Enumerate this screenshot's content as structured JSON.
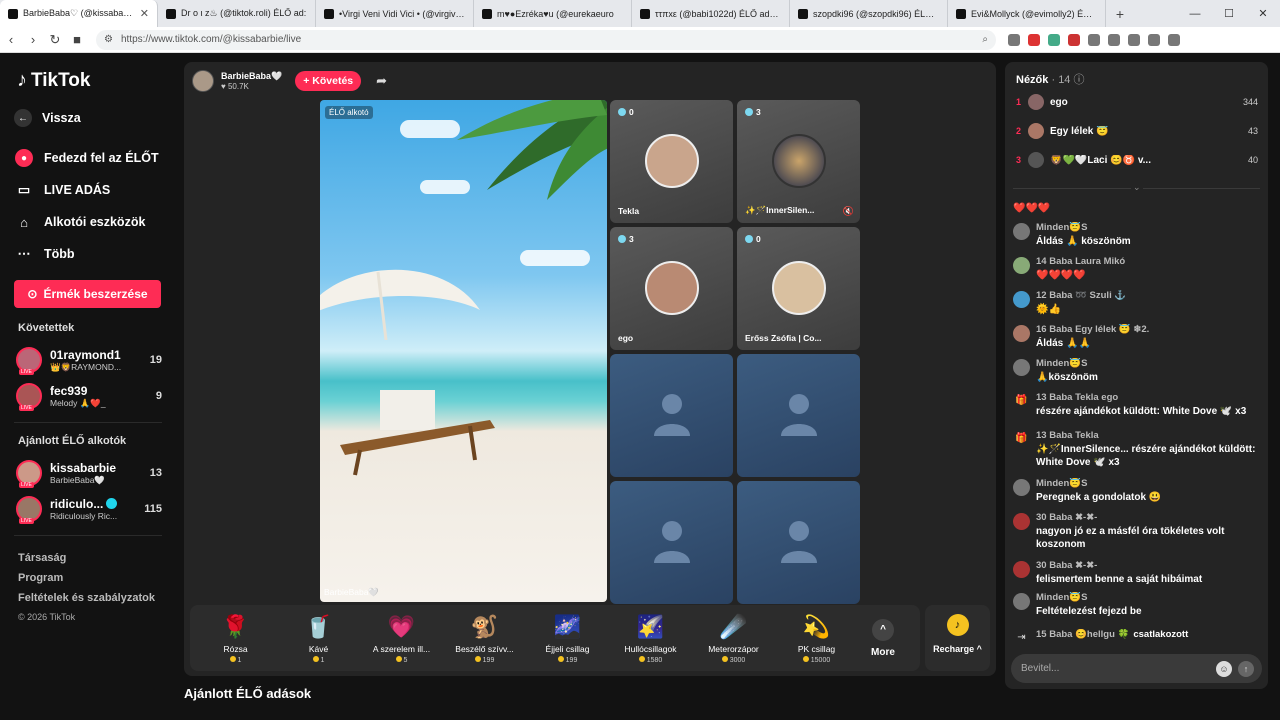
{
  "browser": {
    "tabs": [
      {
        "title": "BarbieBaba♡ (@kissabarbie",
        "active": true
      },
      {
        "title": "Dr o ι z♨ (@tiktok.roli) ÉLŐ ad:",
        "active": false
      },
      {
        "title": "•Virgi Veni Vidi Vici • (@virgivenivic",
        "active": false
      },
      {
        "title": "m♥●Ezréka♥u (@eurekaeuro",
        "active": false
      },
      {
        "title": "ττπxε (@babi1022d) ÉLŐ adásba",
        "active": false
      },
      {
        "title": "szopdki96 (@szopdki96) ÉLŐ adás",
        "active": false
      },
      {
        "title": "Evi&Mollyck (@evimolly2) ÉLŐ adás",
        "active": false
      }
    ],
    "new_tab": "+",
    "url": "https://www.tiktok.com/@kissabarbie/live"
  },
  "sidebar": {
    "logo": "TikTok",
    "back": "Vissza",
    "nav": [
      {
        "label": "Fedezd fel az ÉLŐT",
        "icon": "live-explore-icon"
      },
      {
        "label": "LIVE ADÁS",
        "icon": "camera-icon"
      },
      {
        "label": "Alkotói eszközök",
        "icon": "home-tools-icon"
      },
      {
        "label": "Több",
        "icon": "more-dots-icon"
      }
    ],
    "coin_button": "Érmék beszerzése",
    "following_title": "Követettek",
    "following": [
      {
        "name": "01raymond1",
        "sub": "👑🦁RAYMOND...",
        "count": "19"
      },
      {
        "name": "fec939",
        "sub": "Melody 🙏❤️_",
        "count": "9"
      }
    ],
    "recommended_title": "Ajánlott ÉLŐ alkotók",
    "recommended": [
      {
        "name": "kissabarbie",
        "sub": "BarbieBaba🤍",
        "count": "13",
        "verified": false
      },
      {
        "name": "ridiculo...",
        "sub": "Ridiculously Ric...",
        "count": "115",
        "verified": true
      }
    ],
    "footer_links": [
      "Társaság",
      "Program",
      "Feltételek és szabályzatok"
    ],
    "copyright": "© 2026 TikTok"
  },
  "stage": {
    "host_name": "BarbieBaba🤍",
    "host_likes": "♥ 50.7K",
    "follow_label": "+ Követés",
    "live_badge": "ÉLŐ alkotó",
    "host_label": "BarbieBaba🤍",
    "guests": [
      {
        "name": "Tekla",
        "count": "0",
        "muted": false
      },
      {
        "name": "✨🪄InnerSilen...",
        "count": "3",
        "muted": true
      },
      {
        "name": "ego",
        "count": "3",
        "muted": false
      },
      {
        "name": "Erőss Zsófia | Co...",
        "count": "0",
        "muted": false
      }
    ]
  },
  "gifts": [
    {
      "name": "Rózsa",
      "price": "1",
      "icon": "🌹"
    },
    {
      "name": "Kávé",
      "price": "1",
      "icon": "🥤"
    },
    {
      "name": "A szerelem ill...",
      "price": "5",
      "icon": "💗"
    },
    {
      "name": "Beszélő szívv...",
      "price": "199",
      "icon": "🐒"
    },
    {
      "name": "Éjjeli csillag",
      "price": "199",
      "icon": "🌌"
    },
    {
      "name": "Hullócsillagok",
      "price": "1580",
      "icon": "🌠"
    },
    {
      "name": "Meterorzápor",
      "price": "3000",
      "icon": "☄️"
    },
    {
      "name": "PK csillag",
      "price": "15000",
      "icon": "💫"
    }
  ],
  "more_label": "More",
  "recharge_label": "Recharge ^",
  "section_heading": "Ajánlott ÉLŐ adások",
  "chat": {
    "viewers_title": "Nézők",
    "viewers_count": "· 14",
    "top_viewers": [
      {
        "rank": "1",
        "name": "ego",
        "score": "344"
      },
      {
        "rank": "2",
        "name": "Egy lélek 😇",
        "score": "43"
      },
      {
        "rank": "3",
        "name": "🦁💚🤍Laci 😊♉ v...",
        "score": "40"
      }
    ],
    "messages": [
      {
        "head": "❤️❤️❤️",
        "text": ""
      },
      {
        "head": "Minden😇S",
        "text": "Áldás 🙏 köszönöm"
      },
      {
        "head": "14 Baba Laura Mikó",
        "text": "❤️❤️❤️❤️"
      },
      {
        "head": "12 Baba ➿ Szuli ⚓",
        "text": "🌞👍"
      },
      {
        "head": "16 Baba Egy lélek 😇 ❄2.",
        "text": "Áldás 🙏🙏"
      },
      {
        "head": "Minden😇S",
        "text": "🙏köszönöm"
      },
      {
        "head": "13 Baba Tekla ego",
        "text": "részére ajándékot küldött: White Dove 🕊️ x3"
      },
      {
        "head": "13 Baba Tekla",
        "text": "✨🪄InnerSilence... részére ajándékot küldött: White Dove 🕊️ x3"
      },
      {
        "head": "Minden😇S",
        "text": "Peregnek a gondolatok 😃"
      },
      {
        "head": "30 Baba ✖-✖-",
        "text": "nagyon jó ez a másfél óra tökéletes volt koszonom"
      },
      {
        "head": "30 Baba ✖-✖-",
        "text": "felismertem benne a saját hibáimat"
      },
      {
        "head": "Minden😇S",
        "text": "Feltételezést fejezd be"
      },
      {
        "head": "15 Baba 😊hellgu 🍀",
        "text": "csatlakozott"
      }
    ],
    "input_placeholder": "Bevitel..."
  }
}
